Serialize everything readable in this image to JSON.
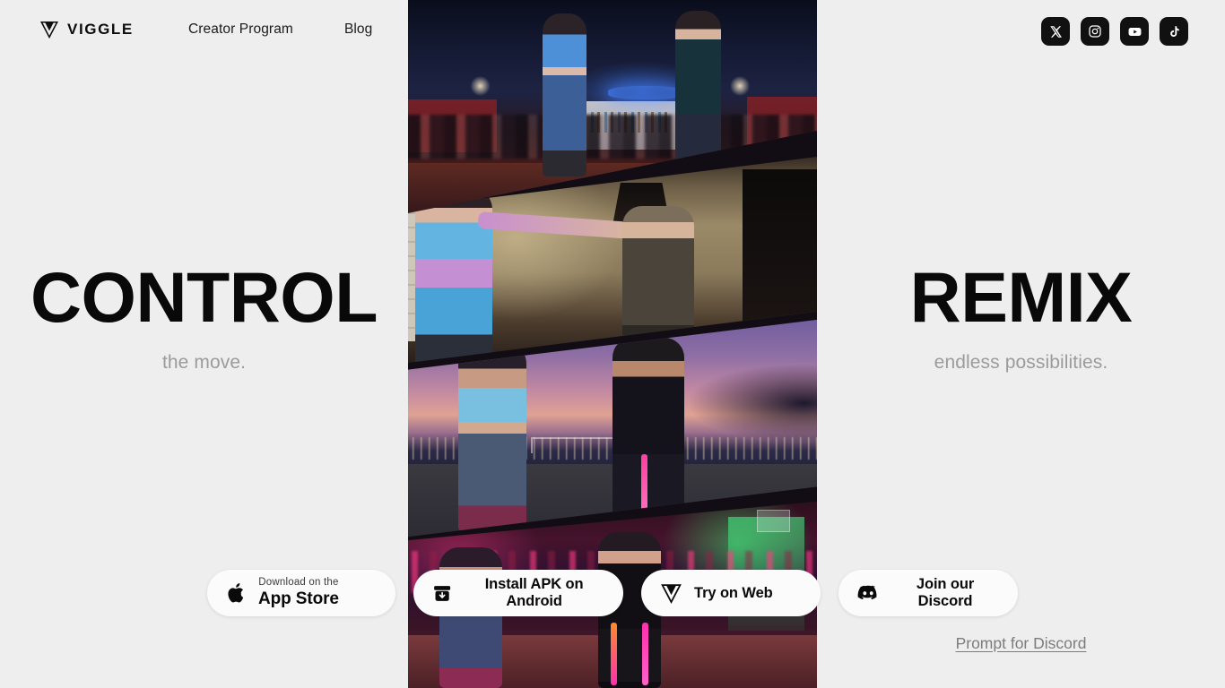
{
  "brand": {
    "name": "VIGGLE",
    "logo_icon": "viggle-v-icon"
  },
  "nav": {
    "items": [
      {
        "label": "Creator Program"
      },
      {
        "label": "Blog"
      }
    ]
  },
  "socials": [
    {
      "name": "x-twitter-icon",
      "label": "X"
    },
    {
      "name": "instagram-icon",
      "label": "Instagram"
    },
    {
      "name": "youtube-icon",
      "label": "YouTube"
    },
    {
      "name": "tiktok-icon",
      "label": "TikTok"
    }
  ],
  "hero": {
    "left": {
      "title": "CONTROL",
      "subtitle": "the move."
    },
    "right": {
      "title": "REMIX",
      "subtitle": "endless possibilities."
    }
  },
  "cta": {
    "app_store": {
      "small": "Download on the",
      "big": "App Store",
      "icon": "apple-icon"
    },
    "apk": {
      "label": "Install APK on Android",
      "icon": "download-box-icon"
    },
    "web": {
      "label": "Try on Web",
      "icon": "viggle-v-icon"
    },
    "discord": {
      "label": "Join our Discord",
      "icon": "discord-icon"
    },
    "prompt_link": {
      "label": "Prompt for Discord"
    }
  },
  "colors": {
    "background": "#efeeee",
    "text_primary": "#090909",
    "text_muted": "#9b9b9b",
    "button_bg": "#fbfbfb",
    "social_bg": "#111112"
  }
}
